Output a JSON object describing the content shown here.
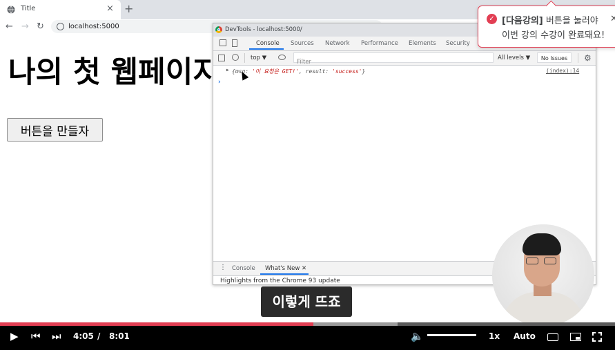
{
  "browser": {
    "tab_title": "Title",
    "url": "localhost:5000",
    "new_tab_symbol": "+"
  },
  "page": {
    "heading": "나의 첫 웹페이지",
    "button_label": "버튼을 만들자"
  },
  "devtools": {
    "window_title": "DevTools - localhost:5000/",
    "tabs": [
      "Console",
      "Sources",
      "Network",
      "Performance",
      "Elements",
      "Security"
    ],
    "active_tab": "Console",
    "context": "top ▼",
    "filter_placeholder": "Filter",
    "levels": "All levels ▼",
    "issues": "No Issues",
    "log": {
      "open": "{msg: ",
      "msg_value": "'이 요청은 GET!'",
      "mid": ", result: ",
      "result_value": "'success'",
      "close": "}",
      "source": "(index):14"
    },
    "prompt": "›",
    "drawer_tabs": [
      "Console",
      "What's New ✕"
    ],
    "drawer_text": "Highlights from the Chrome 93 update"
  },
  "toast": {
    "bold": "[다음강의]",
    "line1_rest": " 버튼을 눌러야",
    "line2": "이번 강의 수강이 완료돼요!",
    "close": "✕"
  },
  "subtitle": "이렇게 뜨죠",
  "player": {
    "current_time": "4:05",
    "separator": "/",
    "duration": "8:01",
    "played_fraction": 0.509,
    "buffered_fraction": 0.647,
    "volume_fraction": 1.0,
    "speed": "1x",
    "quality": "Auto"
  },
  "colors": {
    "accent": "#e23e53",
    "devtools_blue": "#1a73e8"
  }
}
